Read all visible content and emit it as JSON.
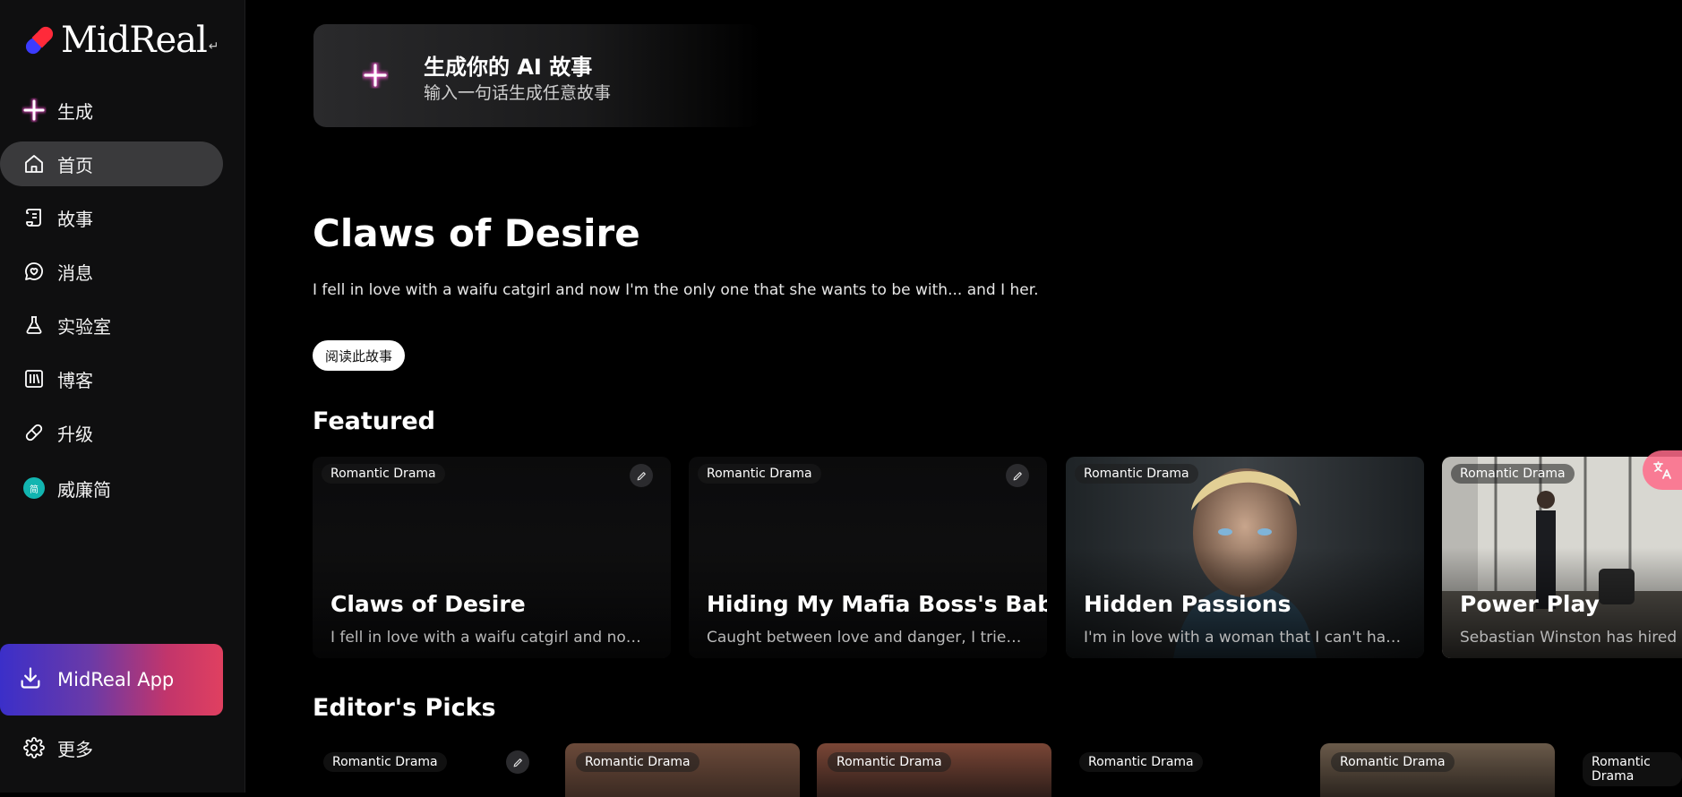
{
  "brand": {
    "name": "MidReal",
    "suffix": "↵"
  },
  "sidebar": {
    "items": [
      {
        "label": "生成",
        "icon": "plus-icon"
      },
      {
        "label": "首页",
        "icon": "home-icon",
        "active": true
      },
      {
        "label": "故事",
        "icon": "scroll-icon"
      },
      {
        "label": "消息",
        "icon": "chat-heart-icon"
      },
      {
        "label": "实验室",
        "icon": "flask-icon"
      },
      {
        "label": "博客",
        "icon": "library-icon"
      },
      {
        "label": "升级",
        "icon": "pill-icon"
      },
      {
        "label": "威廉简",
        "icon": "avatar",
        "avatar_initial": "简"
      }
    ],
    "app_button": {
      "label": "MidReal App",
      "icon": "download-icon"
    },
    "more": {
      "label": "更多",
      "icon": "gear-icon"
    }
  },
  "hero_card": {
    "title": "生成你的 AI 故事",
    "subtitle": "输入一句话生成任意故事"
  },
  "highlight": {
    "title": "Claws of Desire",
    "description": "I fell in love with a waifu catgirl and now I'm the only one that she wants to be with... and I her.",
    "read_button": "阅读此故事"
  },
  "featured": {
    "heading": "Featured",
    "cards": [
      {
        "genre": "Romantic Drama",
        "title": "Claws of Desire",
        "desc": "I fell in love with a waifu catgirl and now I'm...",
        "editable": true
      },
      {
        "genre": "Romantic Drama",
        "title": "Hiding My Mafia Boss's Baby",
        "desc": "Caught between love and danger, I tried to...",
        "editable": true
      },
      {
        "genre": "Romantic Drama",
        "title": "Hidden Passions",
        "desc": "I'm in love with a woman that I can't have....",
        "editable": false
      },
      {
        "genre": "Romantic Drama",
        "title": "Power Play",
        "desc": "Sebastian Winston has hired a n",
        "editable": false
      }
    ]
  },
  "editors_picks": {
    "heading": "Editor's Picks",
    "cards": [
      {
        "genre": "Romantic Drama"
      },
      {
        "genre": "Romantic Drama"
      },
      {
        "genre": "Romantic Drama"
      },
      {
        "genre": "Romantic Drama"
      },
      {
        "genre": "Romantic Drama"
      },
      {
        "genre": "Romantic Drama"
      }
    ]
  },
  "colors": {
    "accent": "#ff6b8a",
    "active_nav": "#3a3a3c",
    "avatar": "#12b5b0"
  }
}
